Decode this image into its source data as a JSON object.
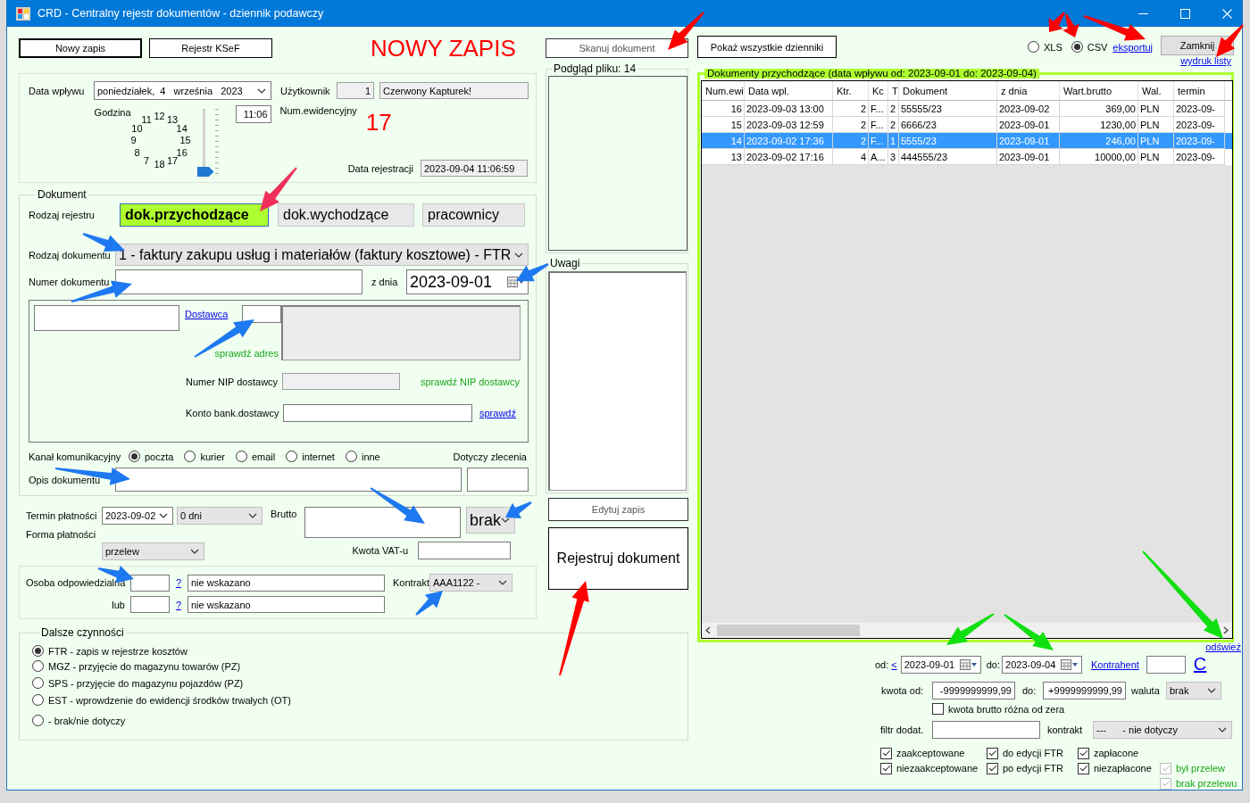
{
  "window": {
    "title": "CRD - Centralny rejestr dokumentów - dziennik podawczy"
  },
  "toolbar": {
    "buttons": [
      "Nowy zapis",
      "Rejestr KSeF"
    ],
    "mode_title": "NOWY ZAPIS"
  },
  "header": {
    "date_label": "Data wpływu",
    "date": {
      "weekday": "poniedziałek,",
      "day": "4",
      "month": "września",
      "year": "2023"
    },
    "user_label": "Użytkownik",
    "user_id": "1",
    "user_name": "Czerwony Kapturek!",
    "hour_label": "Godzina",
    "clock_hours": [
      "12",
      "11",
      "13",
      "10",
      "14",
      "9",
      "15",
      "8",
      "16",
      "7",
      "17",
      "18"
    ],
    "hour_slider": {
      "level": 0
    },
    "time": "11:06",
    "number_label": "Num.ewidencyjny",
    "number": "17",
    "registered_label": "Data rejestracji",
    "registered": "2023-09-04 11:06:59"
  },
  "document": {
    "legend": "Dokument",
    "register_label": "Rodzaj rejestru",
    "registers": [
      {
        "label": "dok.przychodzące",
        "selected": true
      },
      {
        "label": "dok.wychodzące",
        "selected": false
      },
      {
        "label": "pracownicy",
        "selected": false
      }
    ],
    "type_label": "Rodzaj dokumentu",
    "type": "1 - faktury zakupu usług i materiałów (faktury kosztowe) - FTR",
    "number_label": "Numer dokumentu",
    "date_label": "z dnia",
    "date": "2023-09-01",
    "supplier": {
      "link": "Dostawca",
      "check_address": "sprawdź adres",
      "nip_label": "Numer NIP dostawcy",
      "check_nip": "sprawdź NIP dostawcy",
      "account_label": "Konto bank.dostawcy",
      "check_account": "sprawdź"
    },
    "channel_label": "Kanał komunikacyjny",
    "channels": [
      {
        "label": "poczta",
        "selected": true
      },
      {
        "label": "kurier",
        "selected": false
      },
      {
        "label": "email",
        "selected": false
      },
      {
        "label": "internet",
        "selected": false
      },
      {
        "label": "inne",
        "selected": false
      }
    ],
    "order_label": "Dotyczy zlecenia",
    "description_label": "Opis dokumentu"
  },
  "payment": {
    "due_label": "Termin płatności",
    "due_date": "2023-09-02",
    "due_days": "0 dni",
    "gross_label": "Brutto",
    "currency": "brak",
    "method_label": "Forma płatności",
    "method": "przelew",
    "vat_label": "Kwota VAT-u"
  },
  "responsible": {
    "label": "Osoba odpowiedzialna",
    "alt_label": "lub",
    "persons": [
      {
        "help": "?",
        "name": "nie wskazano"
      },
      {
        "help": "?",
        "name": "nie wskazano"
      }
    ],
    "contract_label": "Kontrakt",
    "contract": "AAA1122 -"
  },
  "next_steps": {
    "legend": "Dalsze czynności",
    "options": [
      {
        "label": "FTR - zapis w rejestrze kosztów",
        "selected": true
      },
      {
        "label": "MGZ - przyjęcie do magazynu towarów (PZ)",
        "selected": false
      },
      {
        "label": "SPS - przyjęcie do magazynu pojazdów (PZ)",
        "selected": false
      },
      {
        "label": "EST - wprowdzenie do ewidencji środków trwałych (OT)",
        "selected": false
      },
      {
        "label": "- brak/nie dotyczy",
        "selected": false
      }
    ]
  },
  "middle": {
    "scan_button": "Skanuj dokument",
    "preview_legend": "Podgląd pliku: 14",
    "notes_legend": "Uwagi",
    "edit_button": "Edytuj zapis",
    "register_button": "Rejestruj dokument"
  },
  "journal": {
    "show_all_button": "Pokaż wszystkie dzienniki",
    "formats": [
      {
        "label": "XLS",
        "selected": false
      },
      {
        "label": "CSV",
        "selected": true
      }
    ],
    "export_link": "eksportuj",
    "close_button": "Zamknij",
    "print_link": "wydruk listy",
    "legend": "Dokumenty przychodzące (data wpływu od: 2023-09-01 do: 2023-09-04)",
    "table": {
      "columns": [
        "Num.ewi",
        "Data wpl.",
        "Ktr.",
        "Kc",
        "T",
        "Dokument",
        "z dnia",
        "Wart.brutto",
        "Wal.",
        "termin"
      ],
      "rows": [
        {
          "cells": [
            "16",
            "2023-09-03 13:00",
            "2",
            "F...",
            "2",
            "55555/23",
            "2023-09-02",
            "369,00",
            "PLN",
            "2023-09-"
          ],
          "selected": false
        },
        {
          "cells": [
            "15",
            "2023-09-03 12:59",
            "2",
            "F...",
            "2",
            "6666/23",
            "2023-09-01",
            "1230,00",
            "PLN",
            "2023-09-"
          ],
          "selected": false
        },
        {
          "cells": [
            "14",
            "2023-09-02 17:36",
            "2",
            "F...",
            "1",
            "5555/23",
            "2023-09-01",
            "246,00",
            "PLN",
            "2023-09-"
          ],
          "selected": true
        },
        {
          "cells": [
            "13",
            "2023-09-02 17:16",
            "4",
            "A...",
            "3",
            "444555/23",
            "2023-09-01",
            "10000,00",
            "PLN",
            "2023-09-"
          ],
          "selected": false
        }
      ]
    },
    "refresh_link": "odśwież"
  },
  "filters": {
    "from_label": "od:",
    "prev_link": "<",
    "from": "2023-09-01",
    "to_label": "do:",
    "to": "2023-09-04",
    "contractor_link": "Kontrahent",
    "clear_link": "C",
    "amount_from_label": "kwota od:",
    "amount_from": "-9999999999,99",
    "amount_to_label": "do:",
    "amount_to": "+9999999999,99",
    "currency_label": "waluta",
    "currency": "brak",
    "nonzero": {
      "label": "kwota brutto różna od zera",
      "checked": false
    },
    "extra_label": "filtr dodat.",
    "contract_label": "kontrakt",
    "contract": "---      - nie dotyczy",
    "checks": [
      {
        "label": "zaakceptowane",
        "checked": true,
        "disabled": false
      },
      {
        "label": "do edycji FTR",
        "checked": true,
        "disabled": false
      },
      {
        "label": "zapłacone",
        "checked": true,
        "disabled": false
      },
      {
        "label": "niezaakceptowane",
        "checked": true,
        "disabled": false
      },
      {
        "label": "po edycji FTR",
        "checked": true,
        "disabled": false
      },
      {
        "label": "niezapłacone",
        "checked": true,
        "disabled": false
      },
      {
        "label": "był przelew",
        "checked": true,
        "disabled": true
      },
      {
        "label": "brak przelewu",
        "checked": true,
        "disabled": true
      }
    ]
  }
}
